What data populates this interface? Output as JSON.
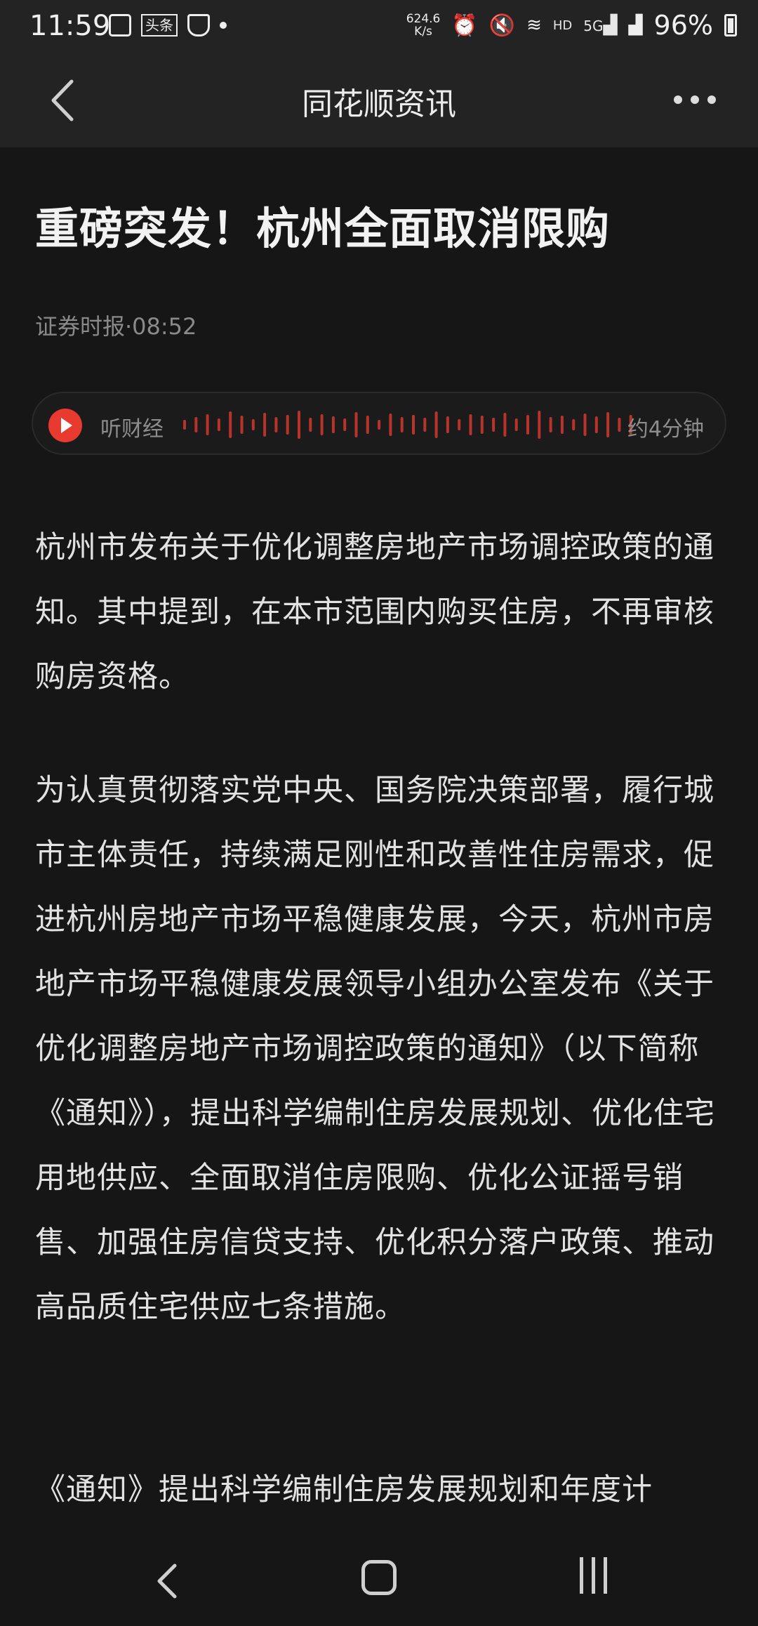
{
  "status_bar": {
    "time": "11:59",
    "badge": "头条",
    "net_speed_value": "624.6",
    "net_speed_unit": "K/s",
    "network": "HD",
    "signal": "5G",
    "battery": "96%"
  },
  "header": {
    "title": "同花顺资讯"
  },
  "article": {
    "title": "重磅突发！杭州全面取消限购",
    "meta": "证券时报·08:52",
    "audio": {
      "label": "听财经",
      "duration": "约4分钟"
    },
    "paragraphs": [
      "杭州市发布关于优化调整房地产市场调控政策的通知。其中提到，在本市范围内购买住房，不再审核购房资格。",
      "为认真贯彻落实党中央、国务院决策部署，履行城市主体责任，持续满足刚性和改善性住房需求，促进杭州房地产市场平稳健康发展，今天，杭州市房地产市场平稳健康发展领导小组办公室发布《关于优化调整房地产市场调控政策的通知》（以下简称《通知》），提出科学编制住房发展规划、优化住宅用地供应、全面取消住房限购、优化公证摇号销售、加强住房信贷支持、优化积分落户政策、推动高品质住宅供应七条措施。",
      "《通知》提出科学编制住房发展规划和年度计"
    ]
  },
  "icons": {
    "back": "chevron-left-icon",
    "more": "more-dots-icon",
    "play": "play-icon",
    "waveform": "waveform-icon",
    "nav_back": "nav-back-icon",
    "nav_home": "nav-home-icon",
    "nav_recents": "nav-recents-icon"
  },
  "colors": {
    "background": "#161616",
    "header_bg": "#232323",
    "accent_red": "#e93a2f",
    "waveform": "#b8332c"
  }
}
